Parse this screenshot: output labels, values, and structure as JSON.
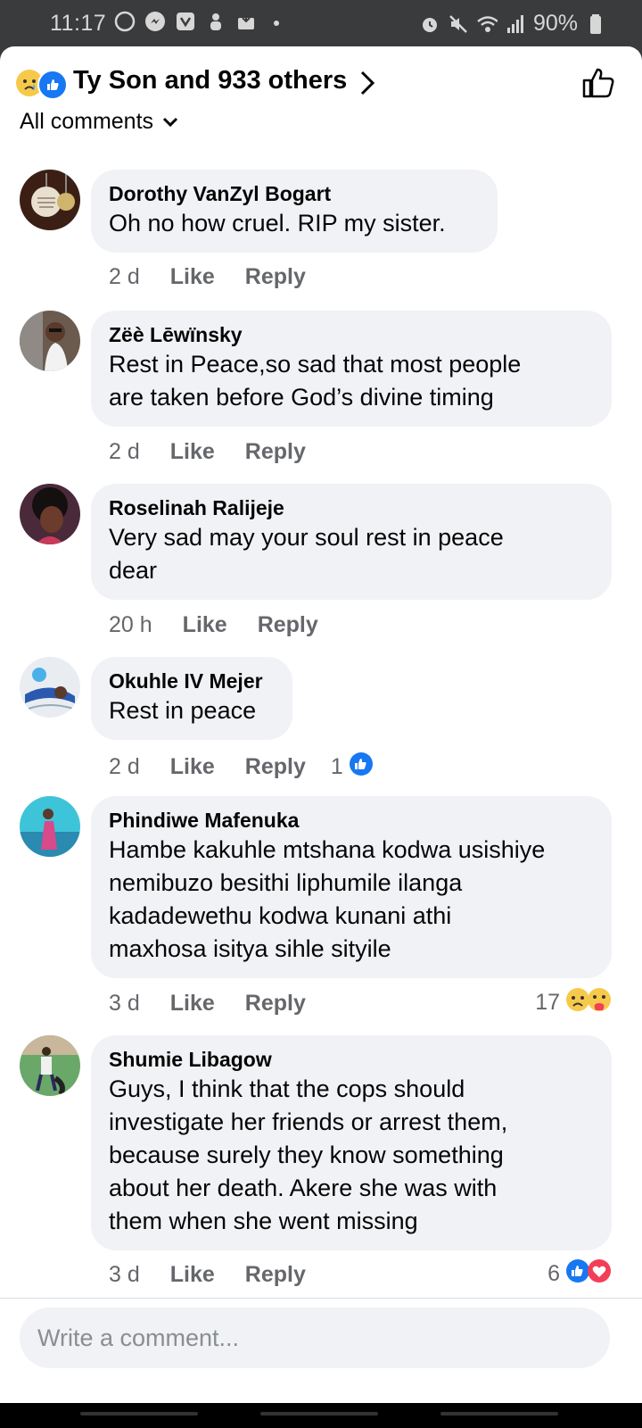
{
  "status_bar": {
    "time": "11:17",
    "battery": "90%"
  },
  "header": {
    "title": "Ty Son and 933 others",
    "sort_label": "All comments"
  },
  "comments": [
    {
      "name": "Dorothy VanZyl Bogart",
      "text": "Oh no how cruel. RIP my sister.",
      "time": "2 d",
      "like": "Like",
      "reply": "Reply",
      "reaction_count": ""
    },
    {
      "name": "Zëè Lēwïnsky",
      "text": "Rest in Peace,so sad that most people\nare taken before God’s divine timing",
      "time": "2 d",
      "like": "Like",
      "reply": "Reply",
      "reaction_count": ""
    },
    {
      "name": "Roselinah Ralijeje",
      "text": "Very sad may your soul rest in peace\ndear",
      "time": "20 h",
      "like": "Like",
      "reply": "Reply",
      "reaction_count": ""
    },
    {
      "name": "Okuhle IV Mejer",
      "text": "Rest in peace",
      "time": "2 d",
      "like": "Like",
      "reply": "Reply",
      "reaction_count": "1"
    },
    {
      "name": "Phindiwe Mafenuka",
      "text": "Hambe kakuhle mtshana kodwa usishiye\nnemibuzo besithi liphumile ilanga\nkadadewethu kodwa kunani athi\nmaxhosa isitya sihle sityile",
      "time": "3 d",
      "like": "Like",
      "reply": "Reply",
      "reaction_count": "17"
    },
    {
      "name": "Shumie Libagow",
      "text": "Guys, I think that the cops should\ninvestigate her friends or arrest them,\nbecause surely they know something\nabout her death. Akere she was with\nthem when she went missing",
      "time": "3 d",
      "like": "Like",
      "reply": "Reply",
      "reaction_count": "6"
    }
  ],
  "composer": {
    "placeholder": "Write a comment..."
  },
  "colors": {
    "brand_blue": "#1877f2",
    "love_red": "#f33e58",
    "bubble_bg": "#f0f2f5",
    "meta_gray": "#65676b"
  }
}
